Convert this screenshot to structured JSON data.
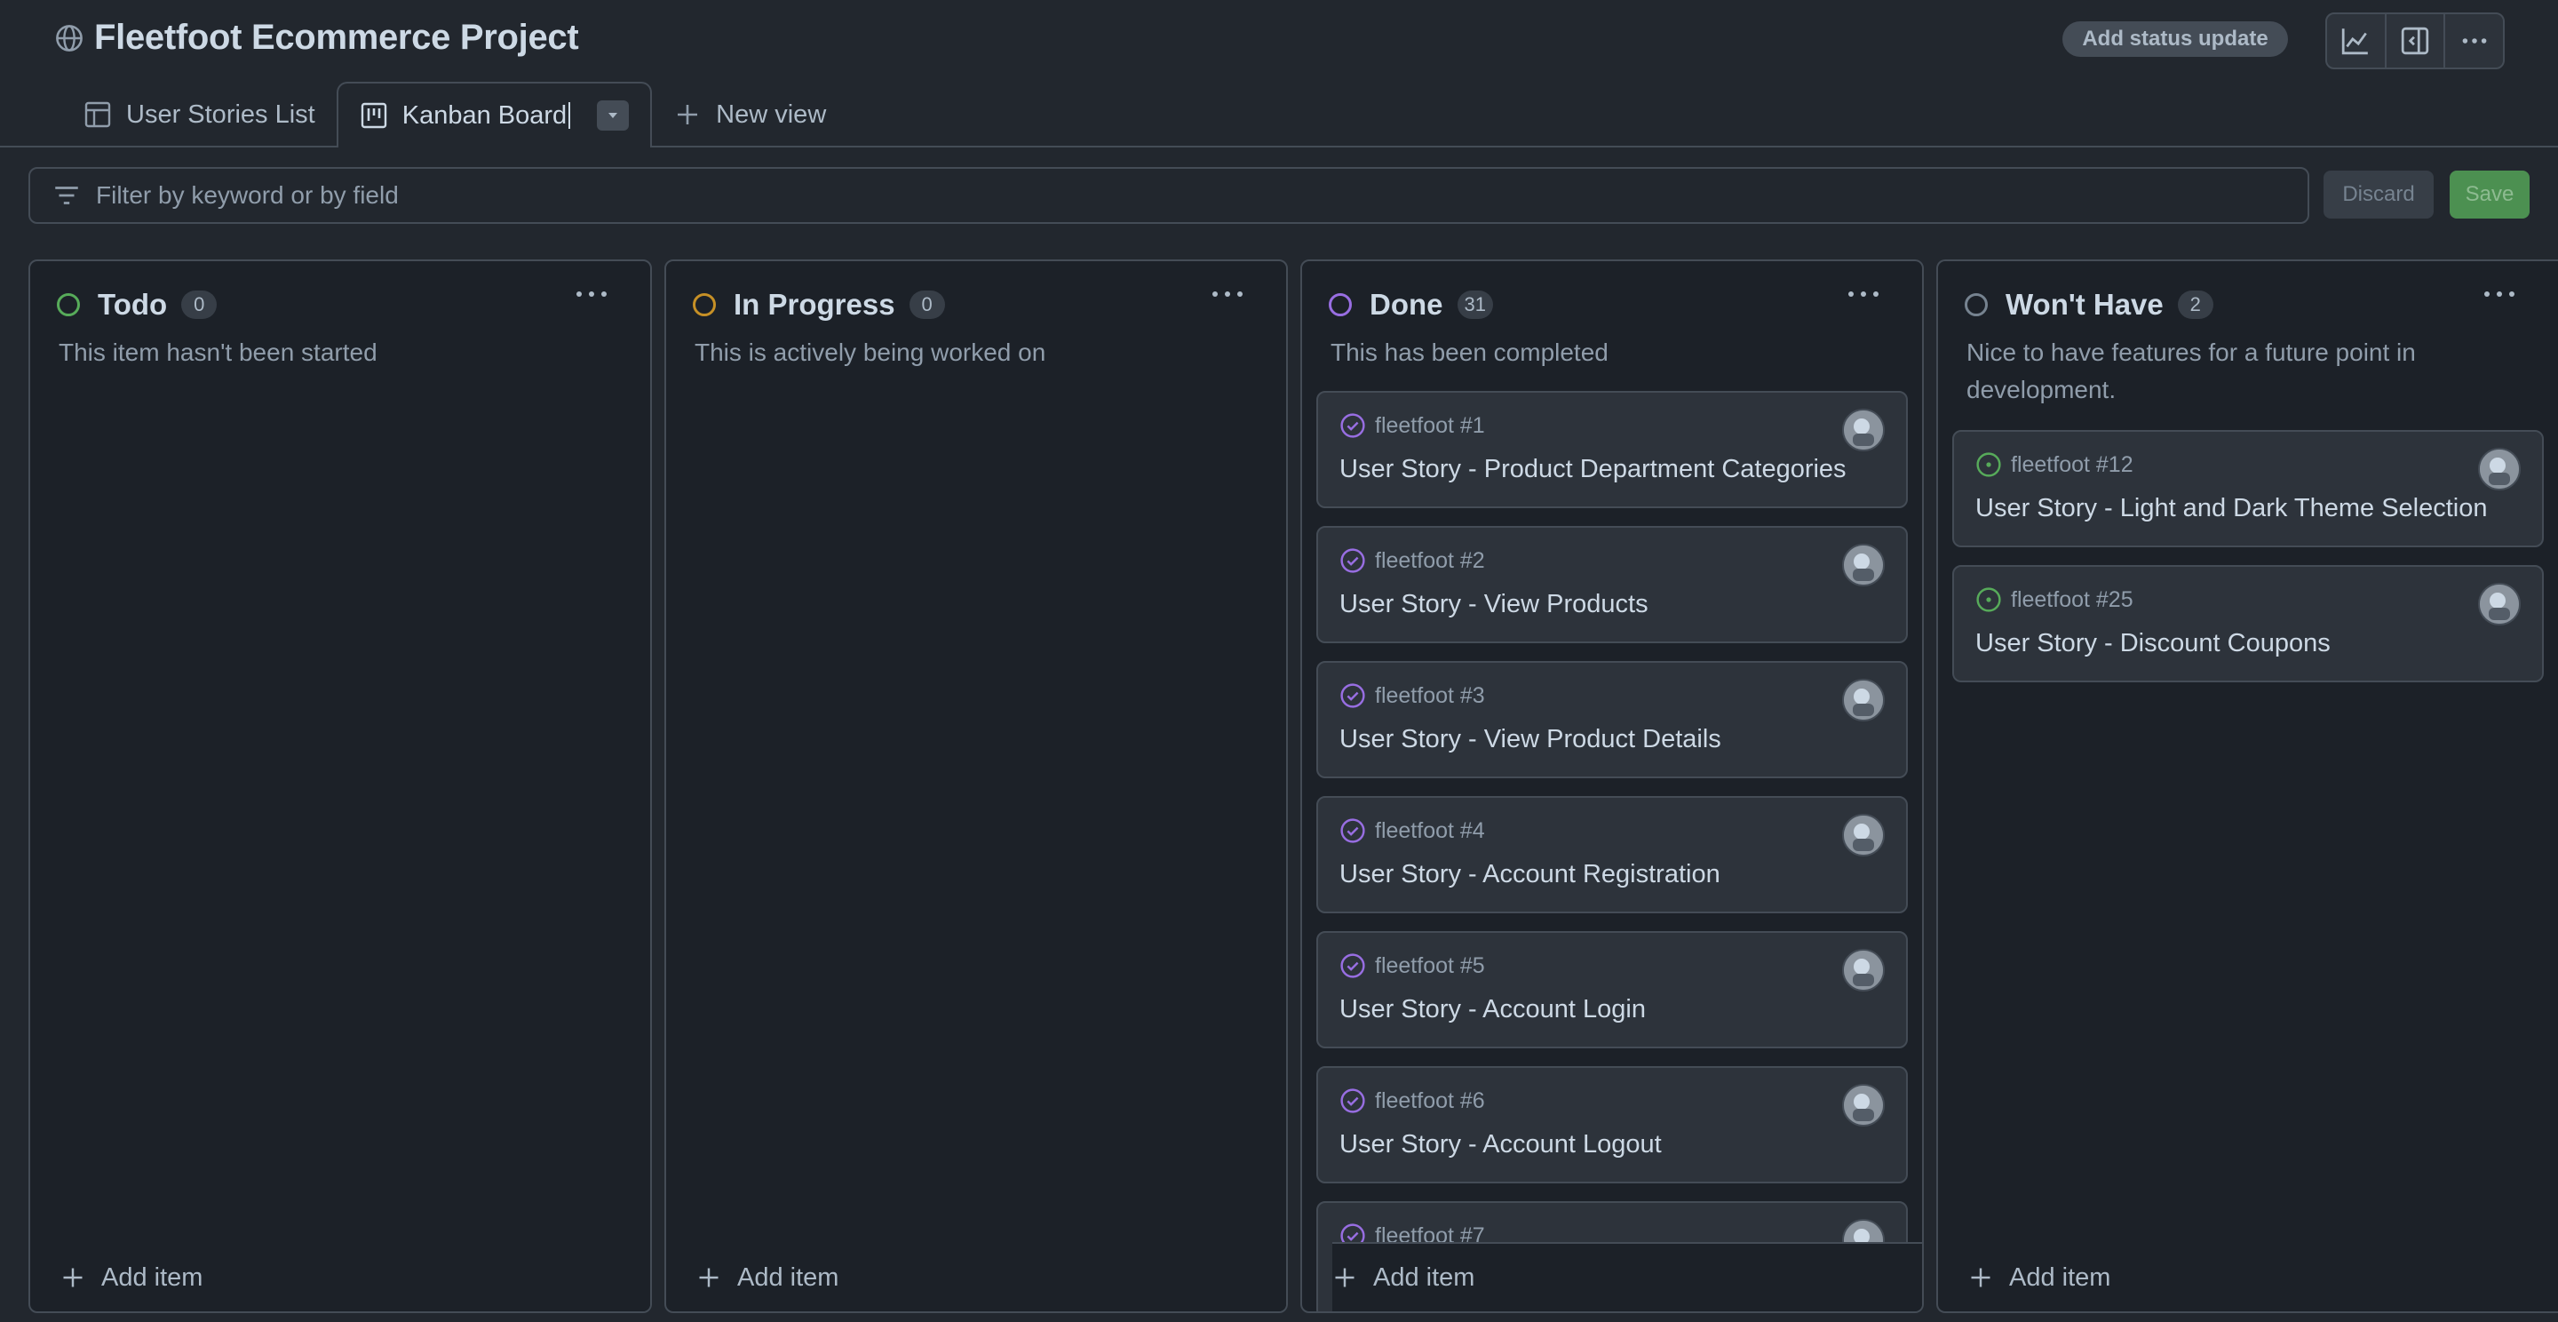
{
  "project": {
    "title": "Fleetfoot Ecommerce Project"
  },
  "header": {
    "status_update_label": "Add status update"
  },
  "tabs": [
    {
      "label": "User Stories List",
      "icon": "table-icon"
    },
    {
      "label": "Kanban Board",
      "icon": "board-icon"
    },
    {
      "label": "New view",
      "icon": "plus-icon"
    }
  ],
  "filter": {
    "placeholder": "Filter by keyword or by field"
  },
  "actions": {
    "discard": "Discard",
    "save": "Save"
  },
  "colors": {
    "todo": "#57ab5a",
    "in_progress": "#c69026",
    "done": "#986ee2",
    "wont_have": "#768390",
    "open_issue": "#57ab5a"
  },
  "columns": [
    {
      "name": "Todo",
      "count": "0",
      "description": "This item hasn't been started",
      "add_label": "Add item",
      "cards": []
    },
    {
      "name": "In Progress",
      "count": "0",
      "description": "This is actively being worked on",
      "add_label": "Add item",
      "cards": []
    },
    {
      "name": "Done",
      "count": "31",
      "description": "This has been completed",
      "add_label": "Add item",
      "cards": [
        {
          "ref": "fleetfoot #1",
          "title": "User Story - Product Department Categories",
          "state": "closed"
        },
        {
          "ref": "fleetfoot #2",
          "title": "User Story - View Products",
          "state": "closed"
        },
        {
          "ref": "fleetfoot #3",
          "title": "User Story - View Product Details",
          "state": "closed"
        },
        {
          "ref": "fleetfoot #4",
          "title": "User Story - Account Registration",
          "state": "closed"
        },
        {
          "ref": "fleetfoot #5",
          "title": "User Story - Account Login",
          "state": "closed"
        },
        {
          "ref": "fleetfoot #6",
          "title": "User Story - Account Logout",
          "state": "closed"
        },
        {
          "ref": "fleetfoot #7",
          "title": "",
          "state": "closed"
        }
      ]
    },
    {
      "name": "Won't Have",
      "count": "2",
      "description": "Nice to have features for a future point in development.",
      "add_label": "Add item",
      "cards": [
        {
          "ref": "fleetfoot #12",
          "title": "User Story - Light and Dark Theme Selection",
          "state": "open"
        },
        {
          "ref": "fleetfoot #25",
          "title": "User Story - Discount Coupons",
          "state": "open"
        }
      ]
    }
  ]
}
